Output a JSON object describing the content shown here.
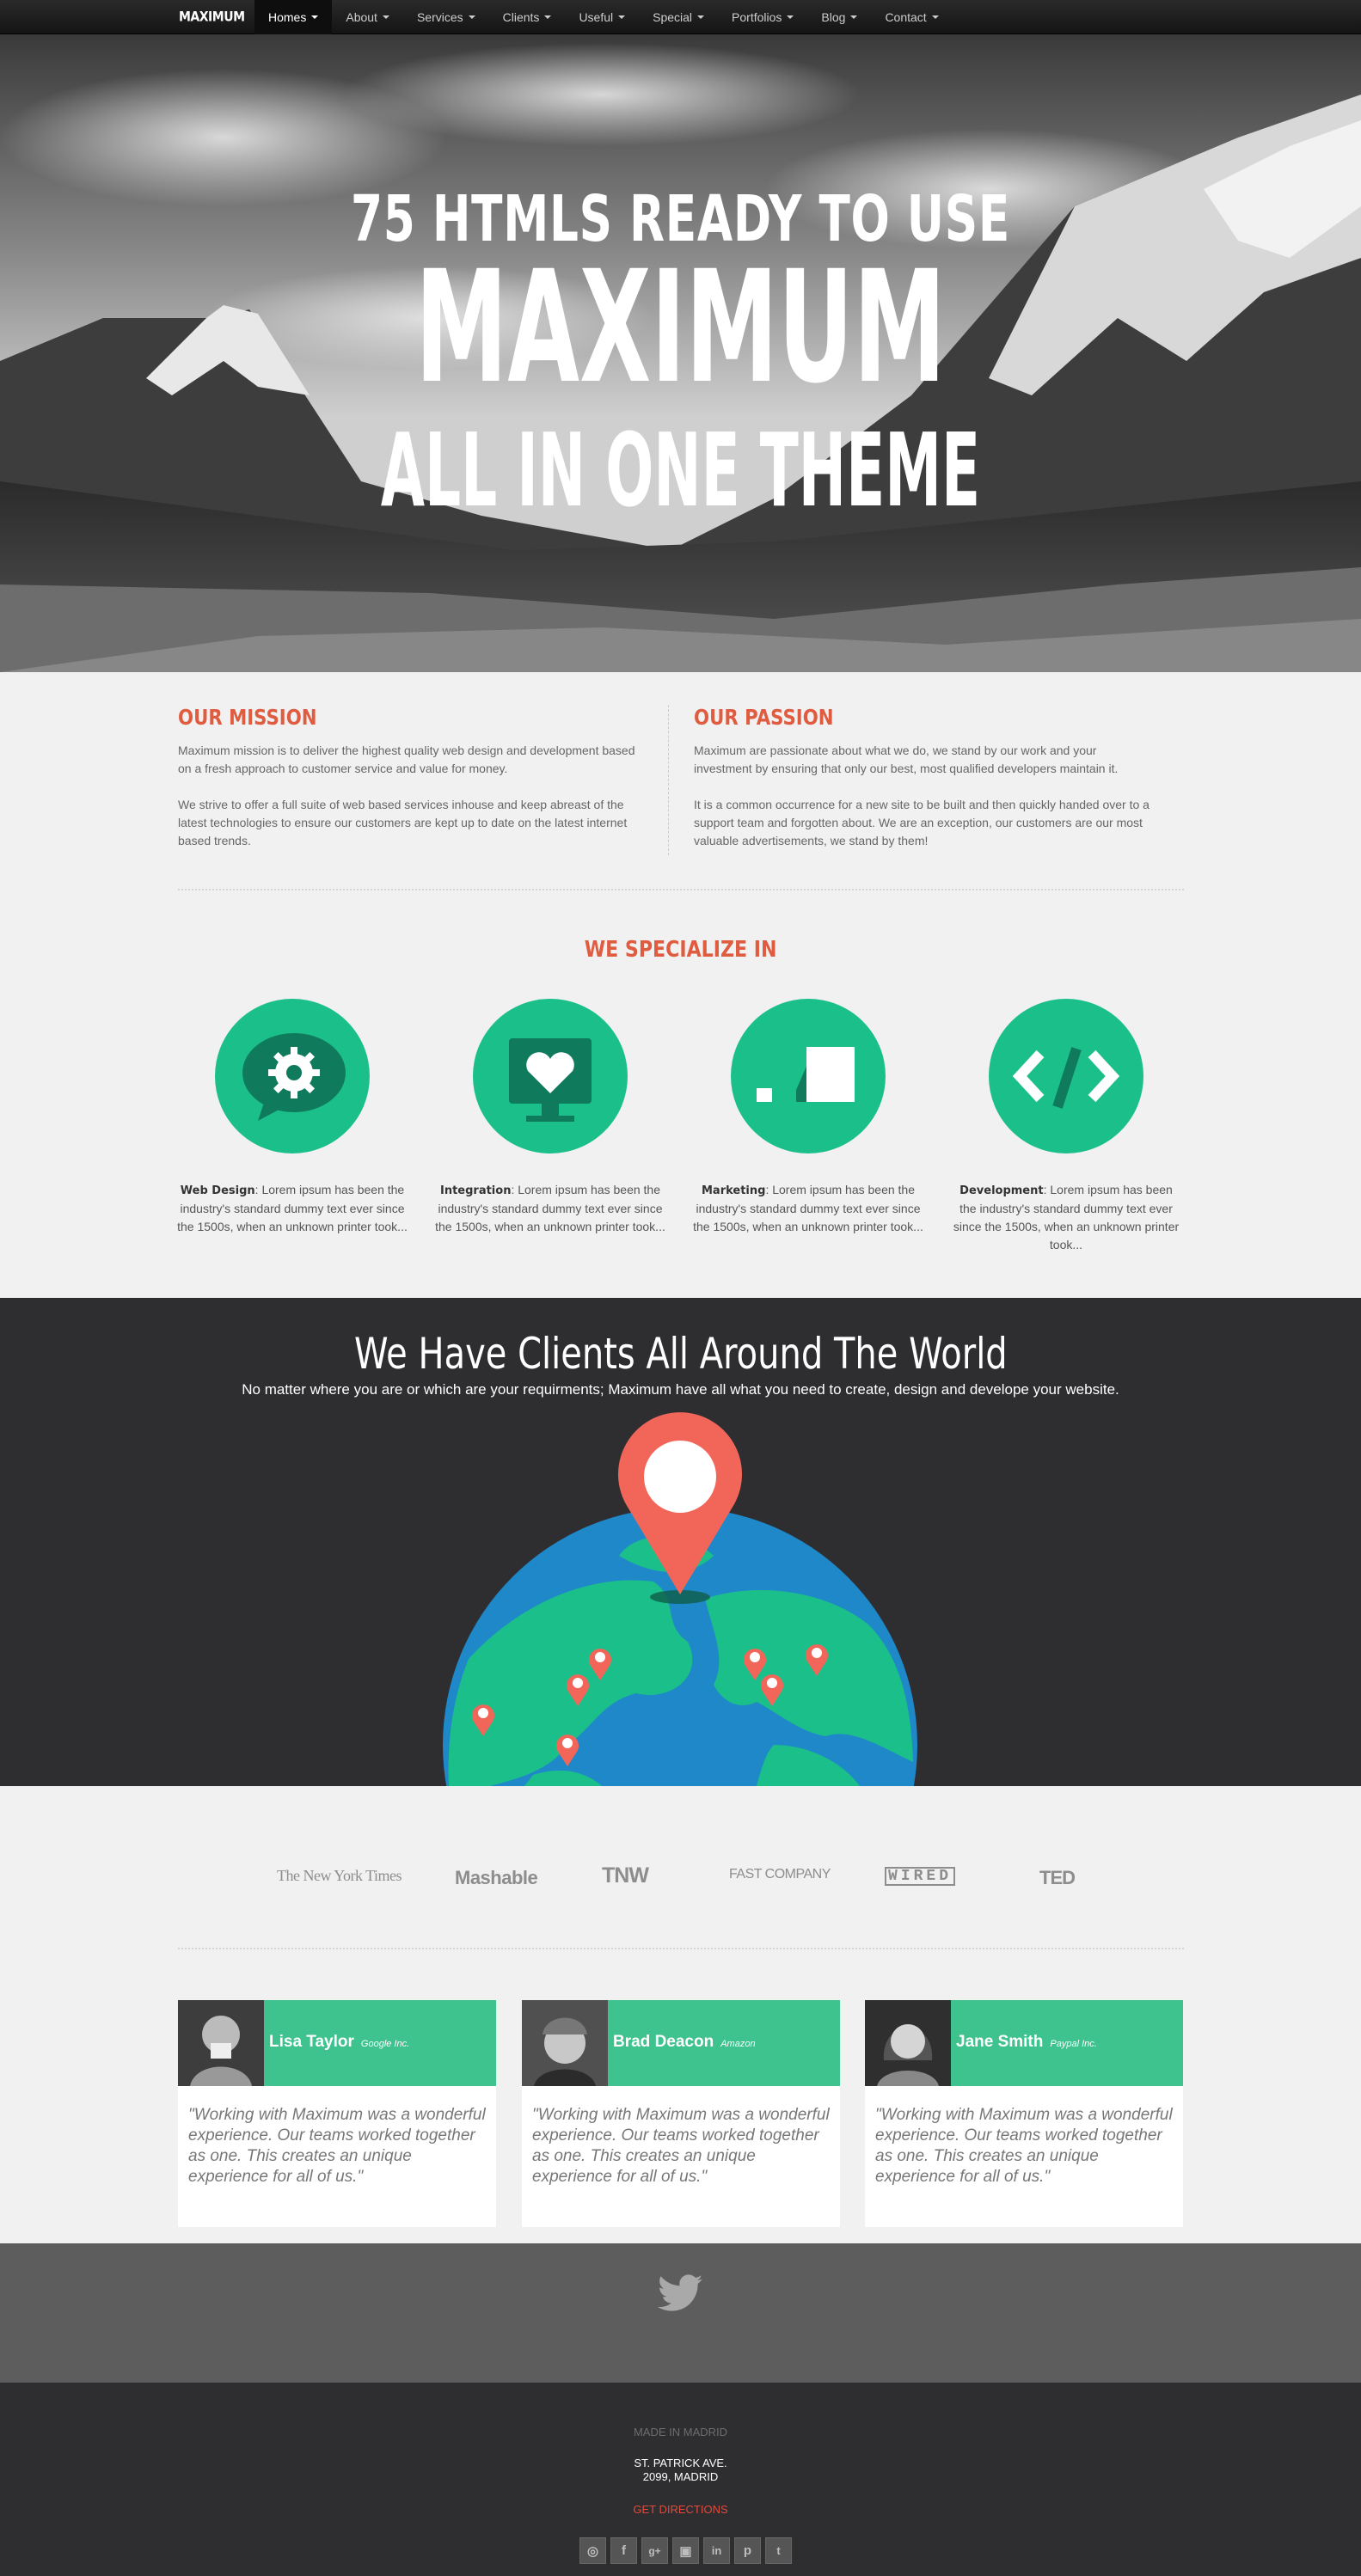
{
  "nav": {
    "brand": "MAXIMUM",
    "items": [
      {
        "label": "Homes"
      },
      {
        "label": "About"
      },
      {
        "label": "Services"
      },
      {
        "label": "Clients"
      },
      {
        "label": "Useful"
      },
      {
        "label": "Special"
      },
      {
        "label": "Portfolios"
      },
      {
        "label": "Blog"
      },
      {
        "label": "Contact"
      }
    ]
  },
  "hero": {
    "line1": "75 HTMLS READY TO USE",
    "line2": "MAXIMUM",
    "line3": "ALL IN ONE THEME"
  },
  "mission": {
    "title": "OUR MISSION",
    "p1": "Maximum mission is to deliver the highest quality web design and development based on a fresh approach to customer service and value for money.",
    "p2": "We strive to offer a full suite of web based services inhouse and keep abreast of the latest technologies to ensure our customers are kept up to date on the latest internet based trends."
  },
  "passion": {
    "title": "OUR PASSION",
    "p1": "Maximum are passionate about what we do, we stand by our work and your investment by ensuring that only our best, most qualified developers maintain it.",
    "p2": "It is a common occurrence for a new site to be built and then quickly handed over to a support team and forgotten about. We are an exception, our customers are our most valuable advertisements, we stand by them!"
  },
  "specialize": {
    "title": "WE SPECIALIZE IN",
    "items": [
      {
        "title": "Web Design",
        "text": ": Lorem ipsum has been the industry's standard dummy text ever since the 1500s, when an unknown printer took..."
      },
      {
        "title": "Integration",
        "text": ": Lorem ipsum has been the industry's standard dummy text ever since the 1500s, when an unknown printer took..."
      },
      {
        "title": "Marketing",
        "text": ": Lorem ipsum has been the industry's standard dummy text ever since the 1500s, when an unknown printer took..."
      },
      {
        "title": "Development",
        "text": ": Lorem ipsum has been the industry's standard dummy text ever since the 1500s, when an unknown printer took..."
      }
    ]
  },
  "world": {
    "title": "We Have Clients All Around The World",
    "subtitle": "No matter where you are or which are your requirments; Maximum have all what you need to create, design and develope your website."
  },
  "logos": [
    "The New York Times",
    "Mashable",
    "TNW",
    "FAST COMPANY",
    "WIRED",
    "TED"
  ],
  "testimonials": [
    {
      "name": "Lisa Taylor",
      "company": "Google Inc.",
      "quote": "\"Working with Maximum was a wonderful experience. Our teams worked together as one. This creates an unique experience for all of us.\""
    },
    {
      "name": "Brad Deacon",
      "company": "Amazon",
      "quote": "\"Working with Maximum was a wonderful experience. Our teams worked together as one. This creates an unique experience for all of us.\""
    },
    {
      "name": "Jane Smith",
      "company": "Paypal Inc.",
      "quote": "\"Working with Maximum was a wonderful experience. Our teams worked together as one. This creates an unique experience for all of us.\""
    }
  ],
  "footer": {
    "made": "MADE IN MADRID",
    "addr1": "ST. PATRICK AVE.",
    "addr2": "2099, MADRID",
    "directions": "GET DIRECTIONS",
    "social": [
      "dribbble-icon",
      "facebook-icon",
      "google-plus-icon",
      "instagram-icon",
      "linkedin-icon",
      "pinterest-icon",
      "twitter-icon"
    ]
  },
  "colors": {
    "accent": "#e05c40",
    "green": "#1bbf8a",
    "dark": "#2e2e31",
    "pin": "#f2665a"
  }
}
